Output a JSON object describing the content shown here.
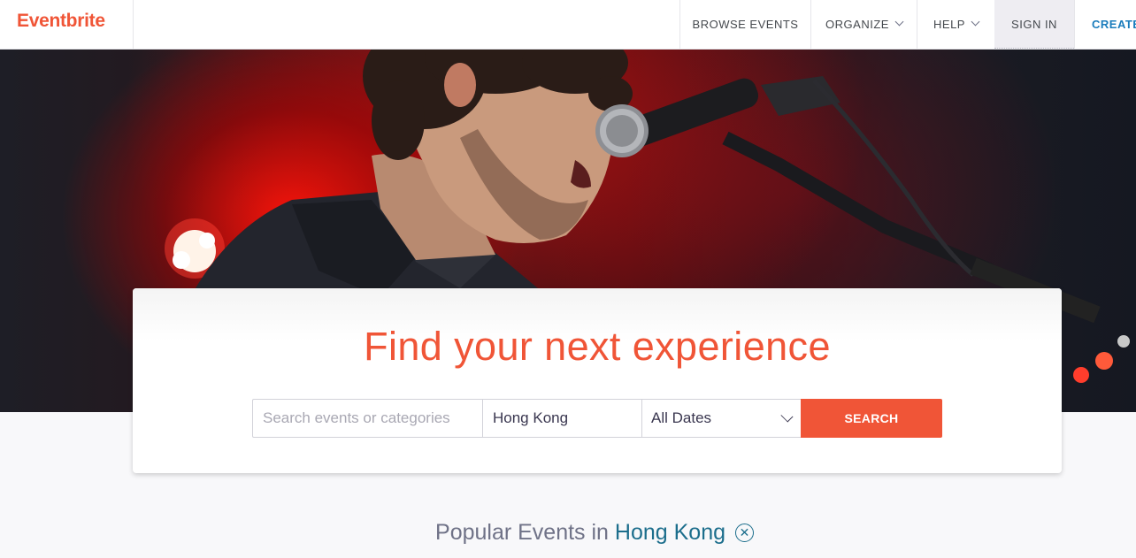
{
  "header": {
    "logo": "Eventbrite",
    "nav": {
      "browse": "BROWSE EVENTS",
      "organize": "ORGANIZE",
      "help": "HELP",
      "sign_in": "SIGN IN",
      "create": "CREATE"
    }
  },
  "hero": {
    "image_icon": "concert-singer-photo",
    "accent_color": "#f05537"
  },
  "search": {
    "headline": "Find your next experience",
    "query_placeholder": "Search events or categories",
    "query_value": "",
    "location_value": "Hong Kong",
    "date_value": "All Dates",
    "button_label": "SEARCH"
  },
  "popular": {
    "prefix": "Popular Events in",
    "city": "Hong Kong",
    "clear_icon": "circle-x-icon"
  }
}
